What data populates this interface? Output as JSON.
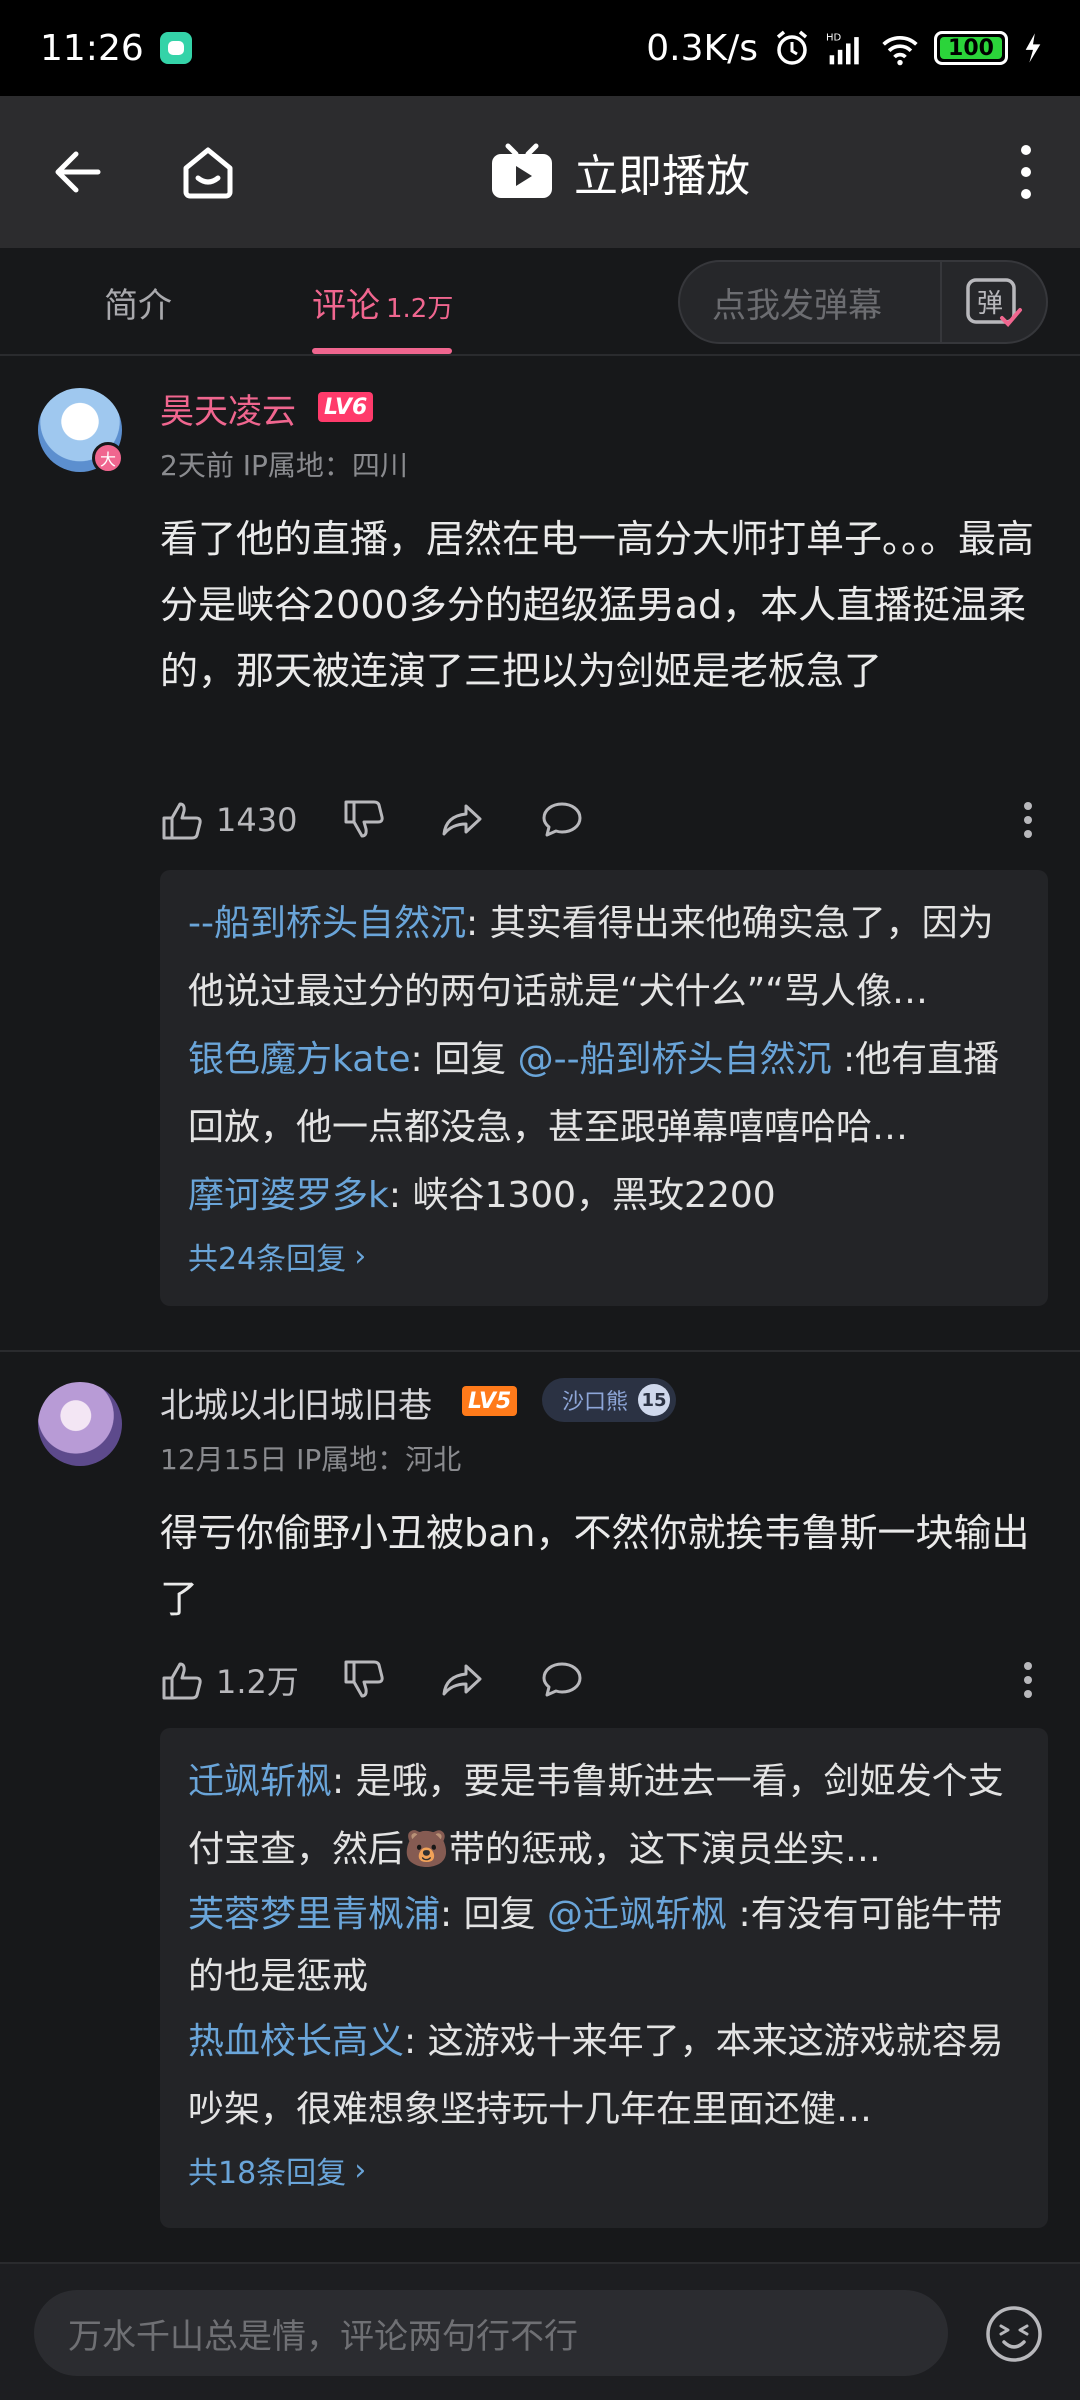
{
  "status_bar": {
    "time": "11:26",
    "net_speed": "0.3K/s",
    "hd": "HD",
    "battery": "100"
  },
  "nav": {
    "title": "立即播放"
  },
  "tabs": {
    "intro": "简介",
    "comments": "评论",
    "comments_count": "1.2万",
    "danmaku_placeholder": "点我发弹幕",
    "danmaku_btn": "弹"
  },
  "comments": [
    {
      "username": "昊天凌云",
      "level": "LV6",
      "avatar_badge": "大",
      "meta": "2天前   IP属地：四川",
      "body": "看了他的直播，居然在电一高分大师打单子。。。最高分是峡谷2000多分的超级猛男ad，本人直播挺温柔的，那天被连演了三把以为剑姬是老板急了",
      "likes": "1430",
      "replies": [
        {
          "author": "--船到桥头自然沉",
          "sep": ": ",
          "text": "其实看得出来他确实急了，因为他说过最过分的两句话就是“犬什么”“骂人像…",
          "mention": ""
        },
        {
          "author": "银色魔方kate",
          "sep": ": ",
          "prefix": "回复 ",
          "mention": "@--船到桥头自然沉",
          "text": " :他有直播回放，他一点都没急，甚至跟弹幕嘻嘻哈哈…"
        },
        {
          "author": "摩诃婆罗多k",
          "sep": ": ",
          "text": "峡谷1300，黑玫2200",
          "mention": ""
        }
      ],
      "more_replies": "共24条回复"
    },
    {
      "username": "北城以北旧城旧巷",
      "level": "LV5",
      "fan_badge": "沙口熊",
      "fan_level": "15",
      "meta": "12月15日   IP属地：河北",
      "body": "得亏你偷野小丑被ban，不然你就挨韦鲁斯一块输出了",
      "likes": "1.2万",
      "replies": [
        {
          "author": "迁飒斩枫",
          "sep": ": ",
          "text": "是哦，要是韦鲁斯进去一看，剑姬发个支付宝查，然后🐻带的惩戒，这下演员坐实…",
          "mention": ""
        },
        {
          "author": "芙蓉梦里青枫浦",
          "sep": ": ",
          "prefix": "回复 ",
          "mention": "@迁飒斩枫",
          "text": " :有没有可能牛带的也是惩戒"
        },
        {
          "author": "热血校长高义",
          "sep": ": ",
          "text": "这游戏十来年了，本来这游戏就容易吵架，很难想象坚持玩十几年在里面还健…",
          "mention": ""
        }
      ],
      "more_replies": "共18条回复"
    }
  ],
  "bottom": {
    "placeholder": "万水千山总是情，评论两句行不行"
  }
}
